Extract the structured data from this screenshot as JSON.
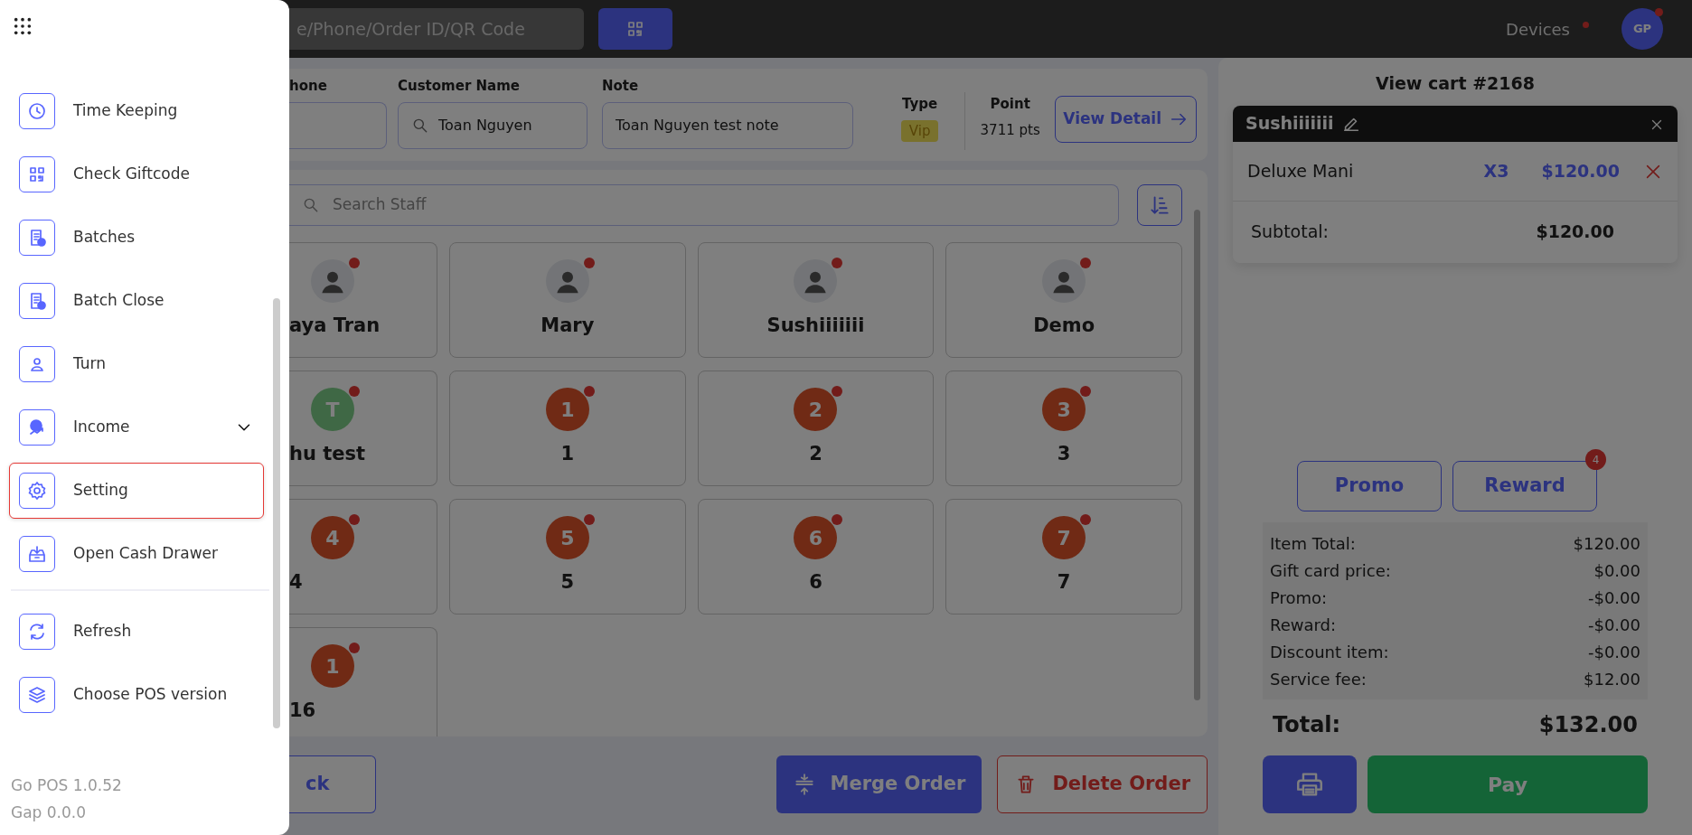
{
  "top_bar": {
    "search": {
      "placeholder": "e/Phone/Order ID/QR Code"
    },
    "devices": {
      "label": "Devices"
    },
    "user": {
      "initials": "GP"
    }
  },
  "customer": {
    "fields": [
      {
        "label": "hone"
      },
      {
        "label": "Customer Name",
        "value": "Toan Nguyen"
      },
      {
        "label": "Note",
        "value": "Toan Nguyen test note"
      }
    ],
    "type": {
      "label": "Type",
      "value": "Vip"
    },
    "point": {
      "label": "Point",
      "value": "3711 pts"
    },
    "view_detail": "View Detail"
  },
  "staff": {
    "search_placeholder": "Search Staff",
    "members": [
      {
        "name": "aya Tran"
      },
      {
        "name": "Mary"
      },
      {
        "name": "Sushiiiiiii"
      },
      {
        "name": "Demo"
      },
      {
        "name": "hu test",
        "avatar": {
          "kind": "letter",
          "text": "T"
        }
      },
      {
        "name": "1",
        "avatar": {
          "kind": "number",
          "text": "1"
        }
      },
      {
        "name": "2",
        "avatar": {
          "kind": "number",
          "text": "2"
        }
      },
      {
        "name": "3",
        "avatar": {
          "kind": "number",
          "text": "3"
        }
      },
      {
        "name": "4",
        "avatar": {
          "kind": "number",
          "text": "4"
        }
      },
      {
        "name": "5",
        "avatar": {
          "kind": "number",
          "text": "5"
        }
      },
      {
        "name": "6",
        "avatar": {
          "kind": "number",
          "text": "6"
        }
      },
      {
        "name": "7",
        "avatar": {
          "kind": "number",
          "text": "7"
        }
      },
      {
        "name": "16",
        "avatar": {
          "kind": "number",
          "text": "1"
        }
      }
    ]
  },
  "actions": [
    {
      "label": "ck",
      "kind": "outline"
    },
    {
      "label": "Merge Order",
      "kind": "primary"
    },
    {
      "label": "Delete Order",
      "kind": "danger"
    }
  ],
  "cart": {
    "title": "View cart #2168",
    "groups": [
      {
        "staff": "Sushiiiiiii",
        "items": [
          {
            "name": "Deluxe Mani",
            "qty": "X3",
            "price": "$120.00"
          }
        ],
        "subtotal_label": "Subtotal:",
        "subtotal": "$120.00"
      }
    ],
    "promo": "Promo",
    "reward": {
      "label": "Reward",
      "badge": "4"
    },
    "summary": [
      {
        "label": "Item Total:",
        "value": "$120.00"
      },
      {
        "label": "Gift card price:",
        "value": "$0.00"
      },
      {
        "label": "Promo:",
        "value": "-$0.00"
      },
      {
        "label": "Reward:",
        "value": "-$0.00"
      },
      {
        "label": "Discount item:",
        "value": "-$0.00"
      },
      {
        "label": "Service fee:",
        "value": "$12.00"
      }
    ],
    "total_label": "Total:",
    "total": "$132.00",
    "pay": "Pay"
  },
  "drawer": {
    "open": true,
    "groups": [
      [
        {
          "label": "Time Keeping",
          "selected": false
        },
        {
          "label": "Check Giftcode",
          "selected": false
        },
        {
          "label": "Batches",
          "selected": false
        },
        {
          "label": "Batch Close",
          "selected": false
        },
        {
          "label": "Turn",
          "selected": false
        },
        {
          "label": "Income",
          "selected": false,
          "expanded": false
        },
        {
          "label": "Setting",
          "selected": true
        },
        {
          "label": "Open Cash Drawer",
          "selected": false
        }
      ],
      [
        {
          "label": "Refresh",
          "selected": false
        },
        {
          "label": "Choose POS version",
          "selected": false
        }
      ]
    ],
    "versions": [
      "Go POS 1.0.52",
      "Gap 0.0.0"
    ]
  }
}
